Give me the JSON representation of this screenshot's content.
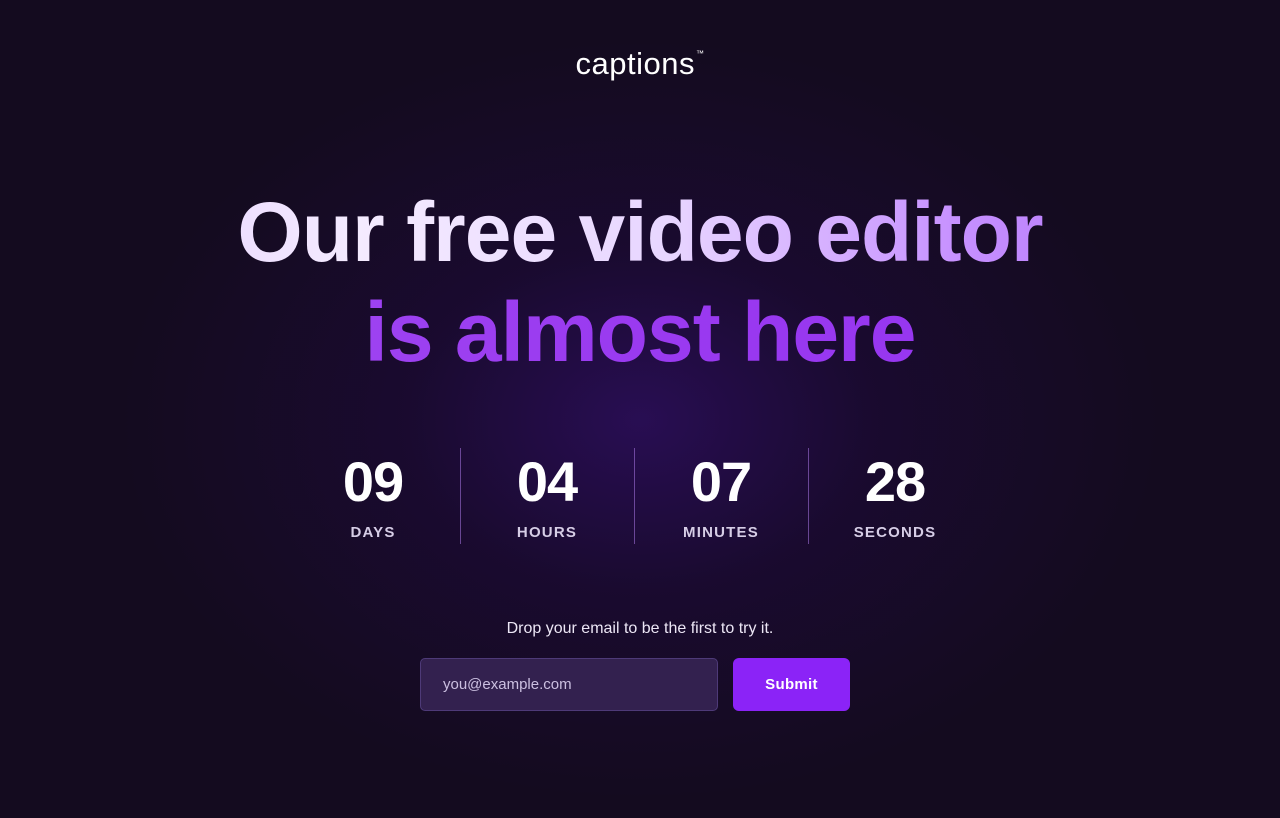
{
  "brand": {
    "name": "captions",
    "trademark": "™"
  },
  "headline": {
    "line1": "Our free video editor",
    "line2": "is almost here"
  },
  "countdown": [
    {
      "value": "09",
      "label": "DAYS"
    },
    {
      "value": "04",
      "label": "HOURS"
    },
    {
      "value": "07",
      "label": "MINUTES"
    },
    {
      "value": "28",
      "label": "SECONDS"
    }
  ],
  "signup": {
    "prompt": "Drop your email to be the first to try it.",
    "email_placeholder": "you@example.com",
    "submit_label": "Submit"
  },
  "colors": {
    "background": "#140b1f",
    "accent": "#8b23f7",
    "input_background": "#33214f"
  }
}
